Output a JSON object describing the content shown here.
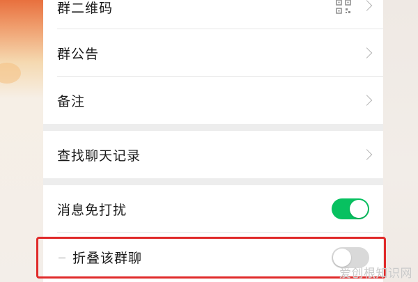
{
  "settings": {
    "qrcode_label": "群二维码",
    "notice_label": "群公告",
    "remark_label": "备注",
    "search_label": "查找聊天记录",
    "dnd_label": "消息免打扰",
    "dnd_on": true,
    "fold_label": "折叠该群聊",
    "fold_on": false
  },
  "colors": {
    "toggle_on": "#07c160",
    "toggle_off": "#d9d9d9",
    "highlight": "#e02a2a"
  },
  "icons": {
    "qrcode": "qrcode-icon",
    "chevron": "chevron-right-icon"
  },
  "watermark": "爱创根知识网"
}
